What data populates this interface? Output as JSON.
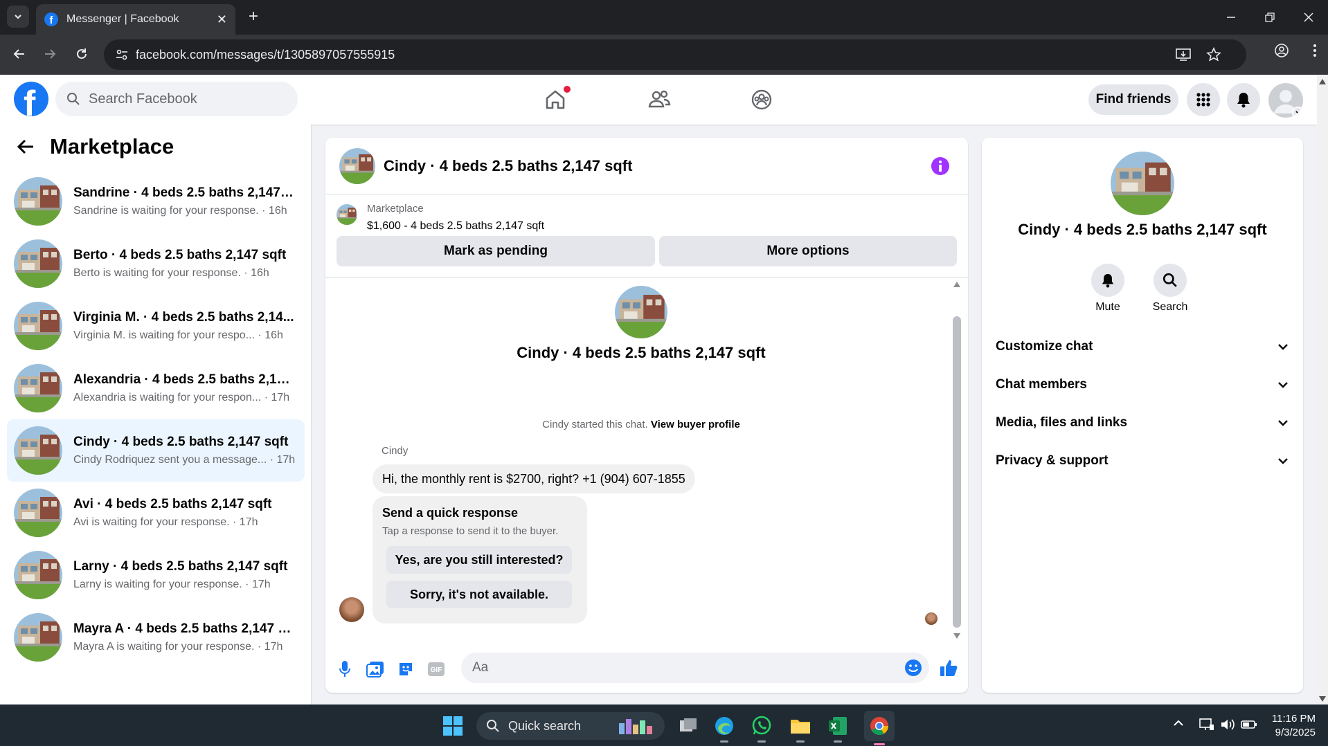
{
  "browser": {
    "tab_title": "Messenger | Facebook",
    "url": "facebook.com/messages/t/1305897057555915"
  },
  "fb": {
    "search_placeholder": "Search Facebook",
    "find_friends": "Find friends"
  },
  "sidebar": {
    "title": "Marketplace",
    "conversations": [
      {
        "name": "Sandrine · 4 beds 2.5 baths 2,147 s...",
        "preview": "Sandrine is waiting for your response. · 16h"
      },
      {
        "name": "Berto · 4 beds 2.5 baths 2,147 sqft",
        "preview": "Berto is waiting for your response. · 16h"
      },
      {
        "name": "Virginia M. · 4 beds 2.5 baths 2,14...",
        "preview": "Virginia M. is waiting for your respo...  · 16h"
      },
      {
        "name": "Alexandria · 4 beds 2.5 baths 2,147...",
        "preview": "Alexandria is waiting for your respon... · 17h"
      },
      {
        "name": "Cindy · 4 beds 2.5 baths 2,147 sqft",
        "preview": "Cindy Rodriquez sent you a message... · 17h"
      },
      {
        "name": "Avi · 4 beds 2.5 baths 2,147 sqft",
        "preview": "Avi is waiting for your response. · 17h"
      },
      {
        "name": "Larny · 4 beds 2.5 baths 2,147 sqft",
        "preview": "Larny is waiting for your response. · 17h"
      },
      {
        "name": "Mayra A · 4 beds 2.5 baths 2,147 s...",
        "preview": "Mayra A is waiting for your response. · 17h"
      }
    ]
  },
  "chat": {
    "title": "Cindy · 4 beds 2.5 baths 2,147 sqft",
    "listing_source": "Marketplace",
    "listing_price": "$1,600 - 4 beds 2.5 baths 2,147 sqft",
    "mark_pending": "Mark as pending",
    "more_options": "More options",
    "started_text": "Cindy started this chat.",
    "view_profile": "View buyer profile",
    "sender": "Cindy",
    "message": "Hi, the monthly rent is $2700, right? +1 (904) 607-1855",
    "quick_title": "Send a quick response",
    "quick_sub": "Tap a response to send it to the buyer.",
    "quick_1": "Yes, are you still interested?",
    "quick_2": "Sorry, it's not available.",
    "composer_placeholder": "Aa"
  },
  "details": {
    "name": "Cindy · 4 beds 2.5 baths 2,147 sqft",
    "mute": "Mute",
    "search": "Search",
    "sections": [
      "Customize chat",
      "Chat members",
      "Media, files and links",
      "Privacy & support"
    ]
  },
  "taskbar": {
    "search": "Quick search",
    "time": "11:16 PM",
    "date": "9/3/2025"
  },
  "colors": {
    "fb_blue": "#1877f2",
    "accent_purple": "#a033ff",
    "active_row": "#ebf5ff"
  }
}
